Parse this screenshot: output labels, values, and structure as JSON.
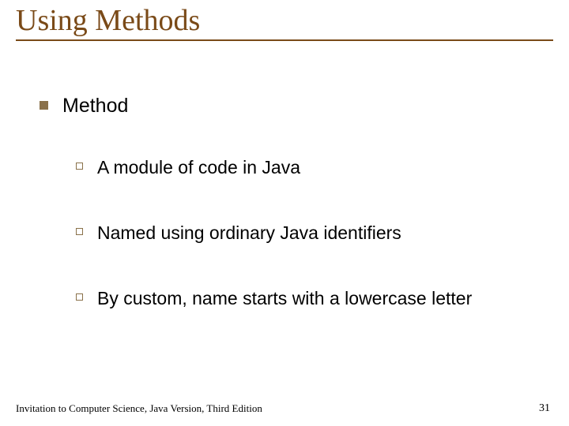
{
  "title": "Using Methods",
  "bullets": {
    "level1": "Method",
    "sub": [
      "A module of code in Java",
      "Named using ordinary Java identifiers",
      "By custom, name starts with a lowercase letter"
    ]
  },
  "footer": {
    "source": "Invitation to Computer Science, Java Version, Third Edition",
    "page": "31"
  }
}
